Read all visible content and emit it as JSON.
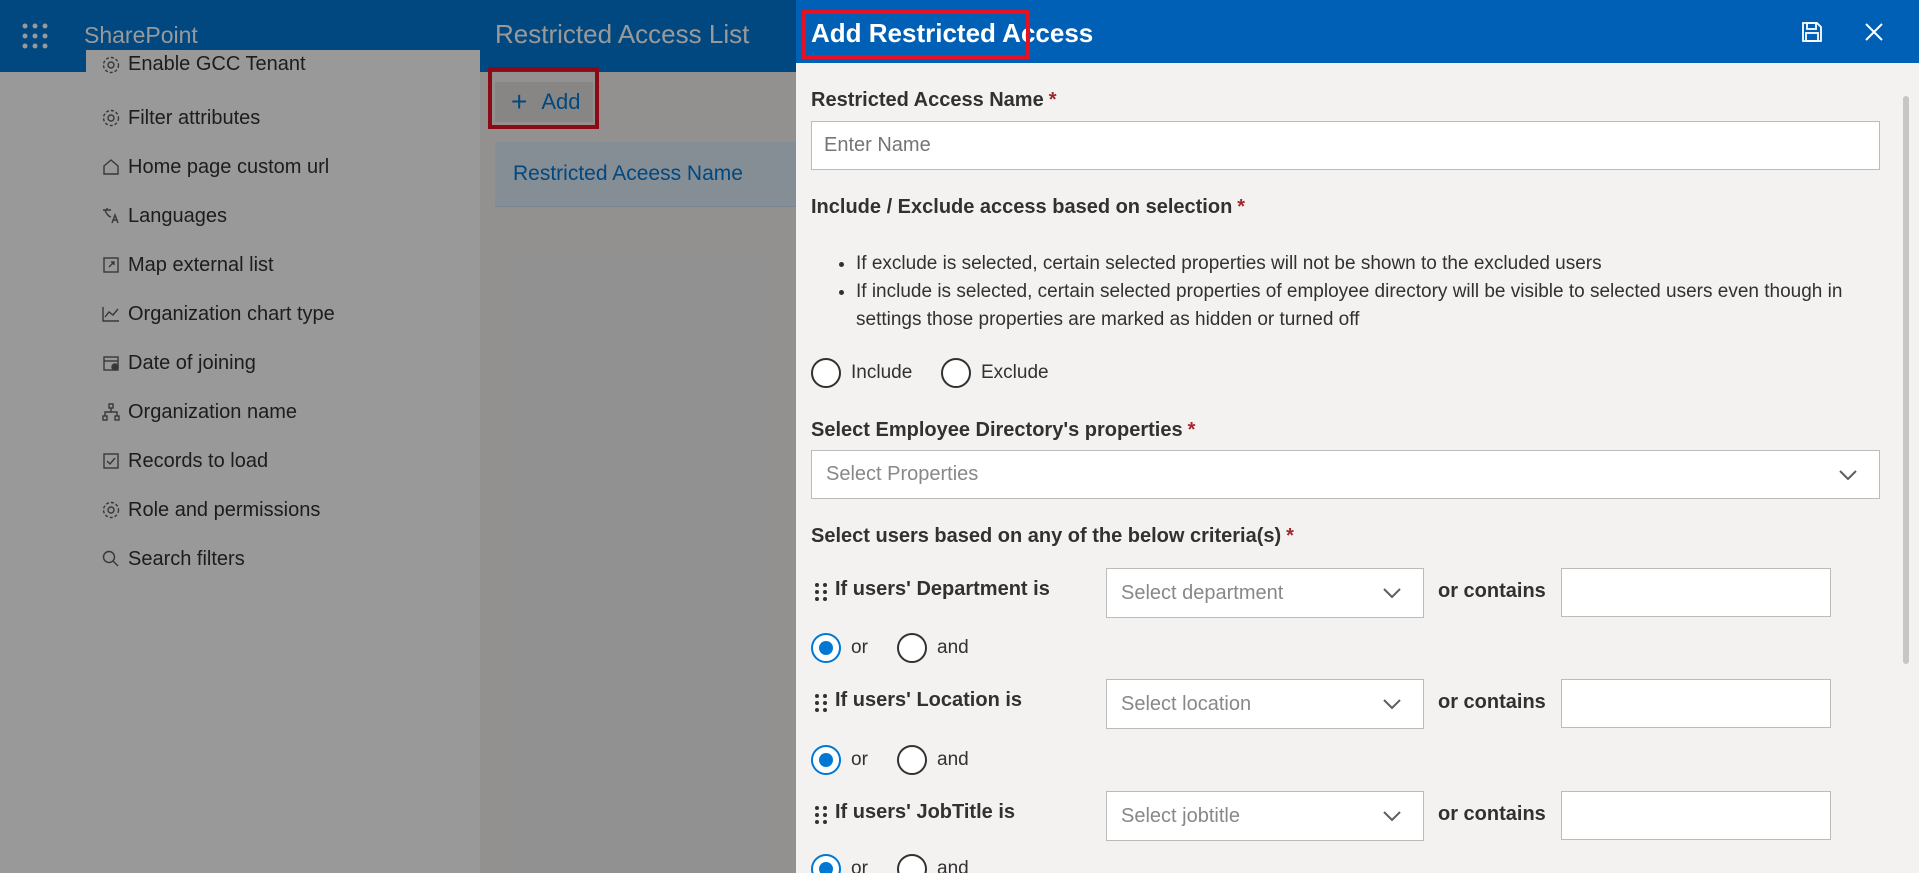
{
  "app": {
    "name": "SharePoint"
  },
  "settings_nav": {
    "items": [
      {
        "label": "Enable GCC Tenant",
        "icon": "gear-icon"
      },
      {
        "label": "Filter attributes",
        "icon": "gear-icon"
      },
      {
        "label": "Home page custom url",
        "icon": "home-icon"
      },
      {
        "label": "Languages",
        "icon": "translate-icon"
      },
      {
        "label": "Map external list",
        "icon": "map-list-icon"
      },
      {
        "label": "Organization chart type",
        "icon": "chart-icon"
      },
      {
        "label": "Date of joining",
        "icon": "calendar-icon"
      },
      {
        "label": "Organization name",
        "icon": "org-icon"
      },
      {
        "label": "Records to load",
        "icon": "checklist-icon"
      },
      {
        "label": "Role and permissions",
        "icon": "gear-icon"
      },
      {
        "label": "Search filters",
        "icon": "search-icon"
      }
    ]
  },
  "list_panel": {
    "title": "Restricted Access List",
    "add_label": "Add",
    "column_header": "Restricted Aceess Name"
  },
  "form": {
    "title": "Add Restricted Access",
    "name_field": {
      "label": "Restricted Access Name",
      "placeholder": "Enter Name",
      "value": ""
    },
    "include_exclude": {
      "label": "Include / Exclude access based on selection",
      "bullets": [
        "If exclude is selected, certain selected properties will not be shown to the excluded users",
        "If include is selected, certain selected properties of employee directory will be visible to selected users even though in settings those properties are marked as hidden or turned off"
      ],
      "options": [
        "Include",
        "Exclude"
      ],
      "selected": null
    },
    "properties": {
      "label": "Select Employee Directory's properties",
      "placeholder": "Select Properties"
    },
    "criteria": {
      "label": "Select users based on any of the below criteria(s)",
      "or_contains_label": "or contains",
      "rows": [
        {
          "label": "If users' Department is",
          "placeholder": "Select department",
          "contains_value": "",
          "connector": "or"
        },
        {
          "label": "If users' Location is",
          "placeholder": "Select location",
          "contains_value": "",
          "connector": "or"
        },
        {
          "label": "If users' JobTitle is",
          "placeholder": "Select jobtitle",
          "contains_value": "",
          "connector": "or"
        }
      ],
      "connector_options": [
        "or",
        "and"
      ]
    },
    "required_marker": "*"
  },
  "colors": {
    "suite_bar": "#0078d4",
    "panel_header": "#0060b6",
    "highlight": "#e81123",
    "accent": "#0078d4",
    "required": "#a4262c"
  }
}
